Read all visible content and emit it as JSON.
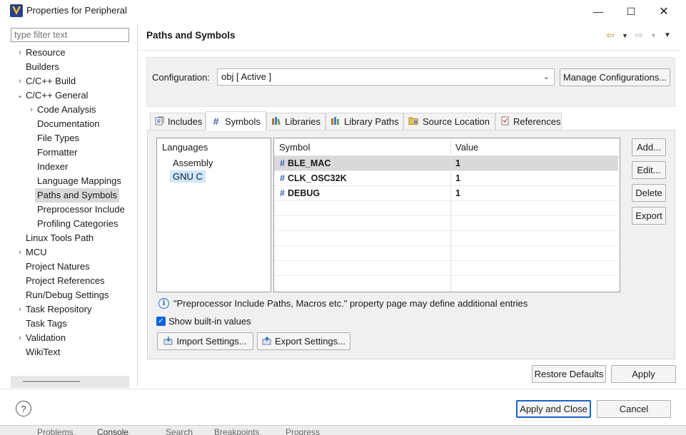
{
  "window": {
    "title": "Properties for Peripheral",
    "minimize": "—",
    "maximize": "☐",
    "close": "✕"
  },
  "filter": {
    "placeholder": "type filter text"
  },
  "tree": {
    "items": [
      {
        "label": "Resource"
      },
      {
        "label": "Builders"
      },
      {
        "label": "C/C++ Build"
      },
      {
        "label": "C/C++ General"
      },
      {
        "label": "Code Analysis"
      },
      {
        "label": "Documentation"
      },
      {
        "label": "File Types"
      },
      {
        "label": "Formatter"
      },
      {
        "label": "Indexer"
      },
      {
        "label": "Language Mappings"
      },
      {
        "label": "Paths and Symbols"
      },
      {
        "label": "Preprocessor Include"
      },
      {
        "label": "Profiling Categories"
      },
      {
        "label": "Linux Tools Path"
      },
      {
        "label": "MCU"
      },
      {
        "label": "Project Natures"
      },
      {
        "label": "Project References"
      },
      {
        "label": "Run/Debug Settings"
      },
      {
        "label": "Task Repository"
      },
      {
        "label": "Task Tags"
      },
      {
        "label": "Validation"
      },
      {
        "label": "WikiText"
      }
    ]
  },
  "page": {
    "title": "Paths and Symbols"
  },
  "config": {
    "label": "Configuration:",
    "value": "obj  [ Active ]",
    "manage_button": "Manage Configurations..."
  },
  "tabs": [
    {
      "label": "Includes",
      "icon": "includes-icon"
    },
    {
      "label": "Symbols",
      "icon": "hash-icon"
    },
    {
      "label": "Libraries",
      "icon": "library-icon"
    },
    {
      "label": "Library Paths",
      "icon": "library-path-icon"
    },
    {
      "label": "Source Location",
      "icon": "folder-icon"
    },
    {
      "label": "References",
      "icon": "references-icon"
    }
  ],
  "languages": {
    "header": "Languages",
    "items": [
      "Assembly",
      "GNU C"
    ],
    "selected": "GNU C"
  },
  "symbols": {
    "columns": [
      "Symbol",
      "Value"
    ],
    "rows": [
      {
        "name": "BLE_MAC",
        "value": "1"
      },
      {
        "name": "CLK_OSC32K",
        "value": "1"
      },
      {
        "name": "DEBUG",
        "value": "1"
      }
    ]
  },
  "side_buttons": {
    "add": "Add...",
    "edit": "Edit...",
    "delete": "Delete",
    "export": "Export"
  },
  "info_text": "\"Preprocessor Include Paths, Macros etc.\" property page may define additional entries",
  "show_builtin": {
    "label": "Show built-in values",
    "checked": true
  },
  "import_settings": "Import Settings...",
  "export_settings": "Export Settings...",
  "restore_defaults": "Restore Defaults",
  "apply": "Apply",
  "apply_and_close": "Apply and Close",
  "cancel": "Cancel",
  "help": "?",
  "bottom_tabs": [
    "Problems",
    "Console",
    "Search",
    "Breakpoints",
    "Progress"
  ],
  "colors": {
    "accent": "#1766c9",
    "selection": "#d9d9d9",
    "lang_selection": "#cde8ff",
    "hash": "#3a5fb0"
  }
}
